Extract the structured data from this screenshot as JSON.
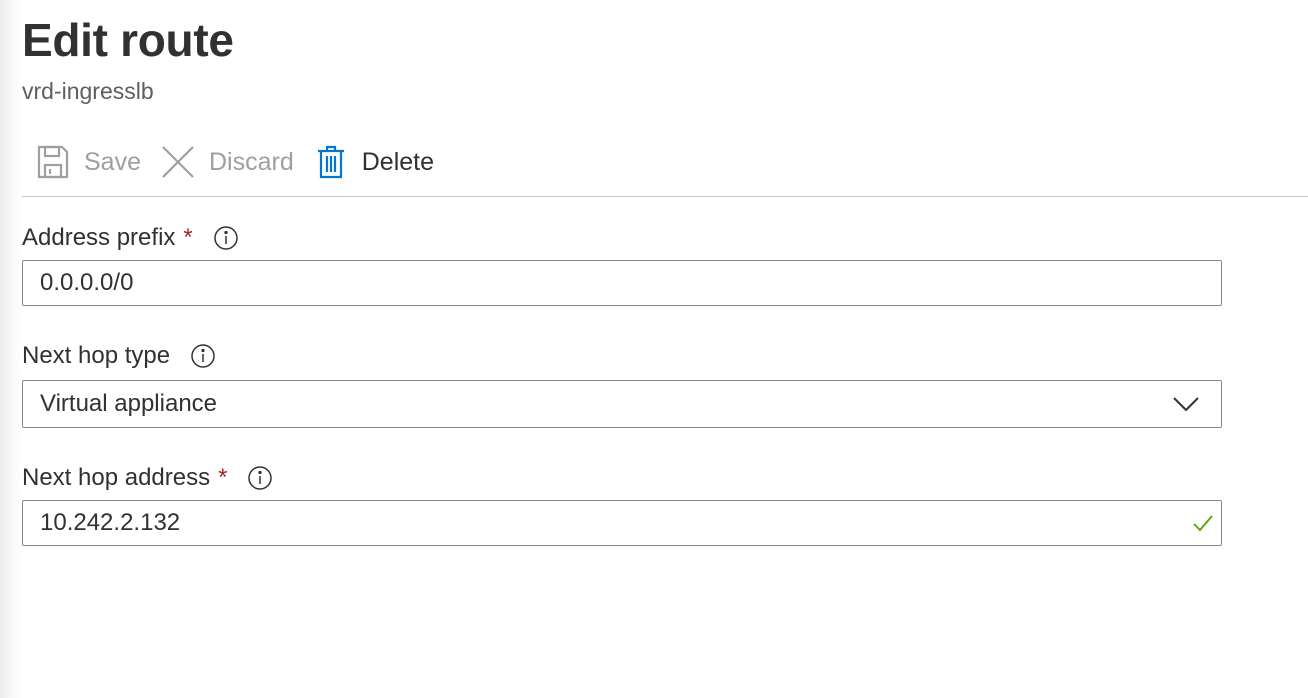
{
  "header": {
    "title": "Edit route",
    "subtitle": "vrd-ingresslb"
  },
  "toolbar": {
    "save_label": "Save",
    "discard_label": "Discard",
    "delete_label": "Delete"
  },
  "form": {
    "address_prefix": {
      "label": "Address prefix",
      "required_mark": "*",
      "value": "0.0.0.0/0"
    },
    "next_hop_type": {
      "label": "Next hop type",
      "selected": "Virtual appliance"
    },
    "next_hop_address": {
      "label": "Next hop address",
      "required_mark": "*",
      "value": "10.242.2.132"
    }
  },
  "icons": {
    "save": "save-icon",
    "discard": "close-icon",
    "delete": "trash-icon",
    "info": "info-icon",
    "dropdown": "chevron-down-icon",
    "valid": "checkmark-icon"
  },
  "colors": {
    "accent": "#0078d4",
    "required": "#a4262c",
    "valid": "#57a300",
    "disabled_text": "#a19f9d"
  }
}
